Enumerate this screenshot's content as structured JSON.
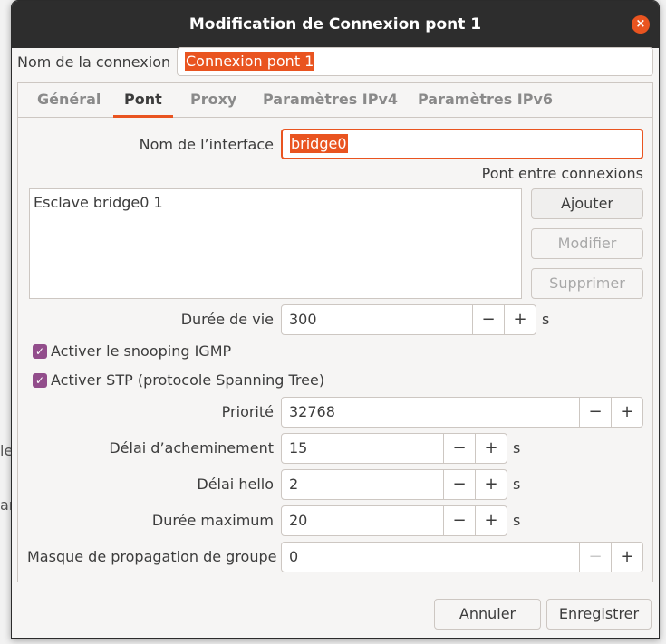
{
  "window": {
    "title": "Modification de Connexion pont 1",
    "close_glyph": "×"
  },
  "background_fragments": [
    "le",
    "ar"
  ],
  "connection_name": {
    "label": "Nom de la connexion",
    "value": "Connexion pont 1"
  },
  "tabs": [
    {
      "label": "Général",
      "active": false
    },
    {
      "label": "Pont",
      "active": true
    },
    {
      "label": "Proxy",
      "active": false
    },
    {
      "label": "Paramètres IPv4",
      "active": false
    },
    {
      "label": "Paramètres IPv6",
      "active": false
    }
  ],
  "bridge": {
    "interface_label": "Nom de l’interface",
    "interface_value": "bridge0",
    "connections_label": "Pont entre connexions",
    "connections": [
      "Esclave bridge0 1"
    ],
    "buttons": {
      "add": "Ajouter",
      "edit": "Modifier",
      "delete": "Supprimer"
    },
    "ageing_time": {
      "label": "Durée de vie",
      "value": "300",
      "unit": "s"
    },
    "igmp_snooping": {
      "label": "Activer le snooping IGMP",
      "checked": true
    },
    "stp": {
      "label": "Activer STP (protocole Spanning Tree)",
      "checked": true
    },
    "priority": {
      "label": "Priorité",
      "value": "32768"
    },
    "forward_delay": {
      "label": "Délai d’acheminement",
      "value": "15",
      "unit": "s"
    },
    "hello_time": {
      "label": "Délai hello",
      "value": "2",
      "unit": "s"
    },
    "max_age": {
      "label": "Durée maximum",
      "value": "20",
      "unit": "s"
    },
    "group_mask": {
      "label": "Masque de propagation de groupe",
      "value": "0"
    },
    "minus_glyph": "−",
    "plus_glyph": "+"
  },
  "footer": {
    "cancel": "Annuler",
    "save": "Enregistrer"
  },
  "colors": {
    "accent": "#e95420",
    "checkbox": "#924d8b",
    "titlebar": "#2d2d2d"
  }
}
